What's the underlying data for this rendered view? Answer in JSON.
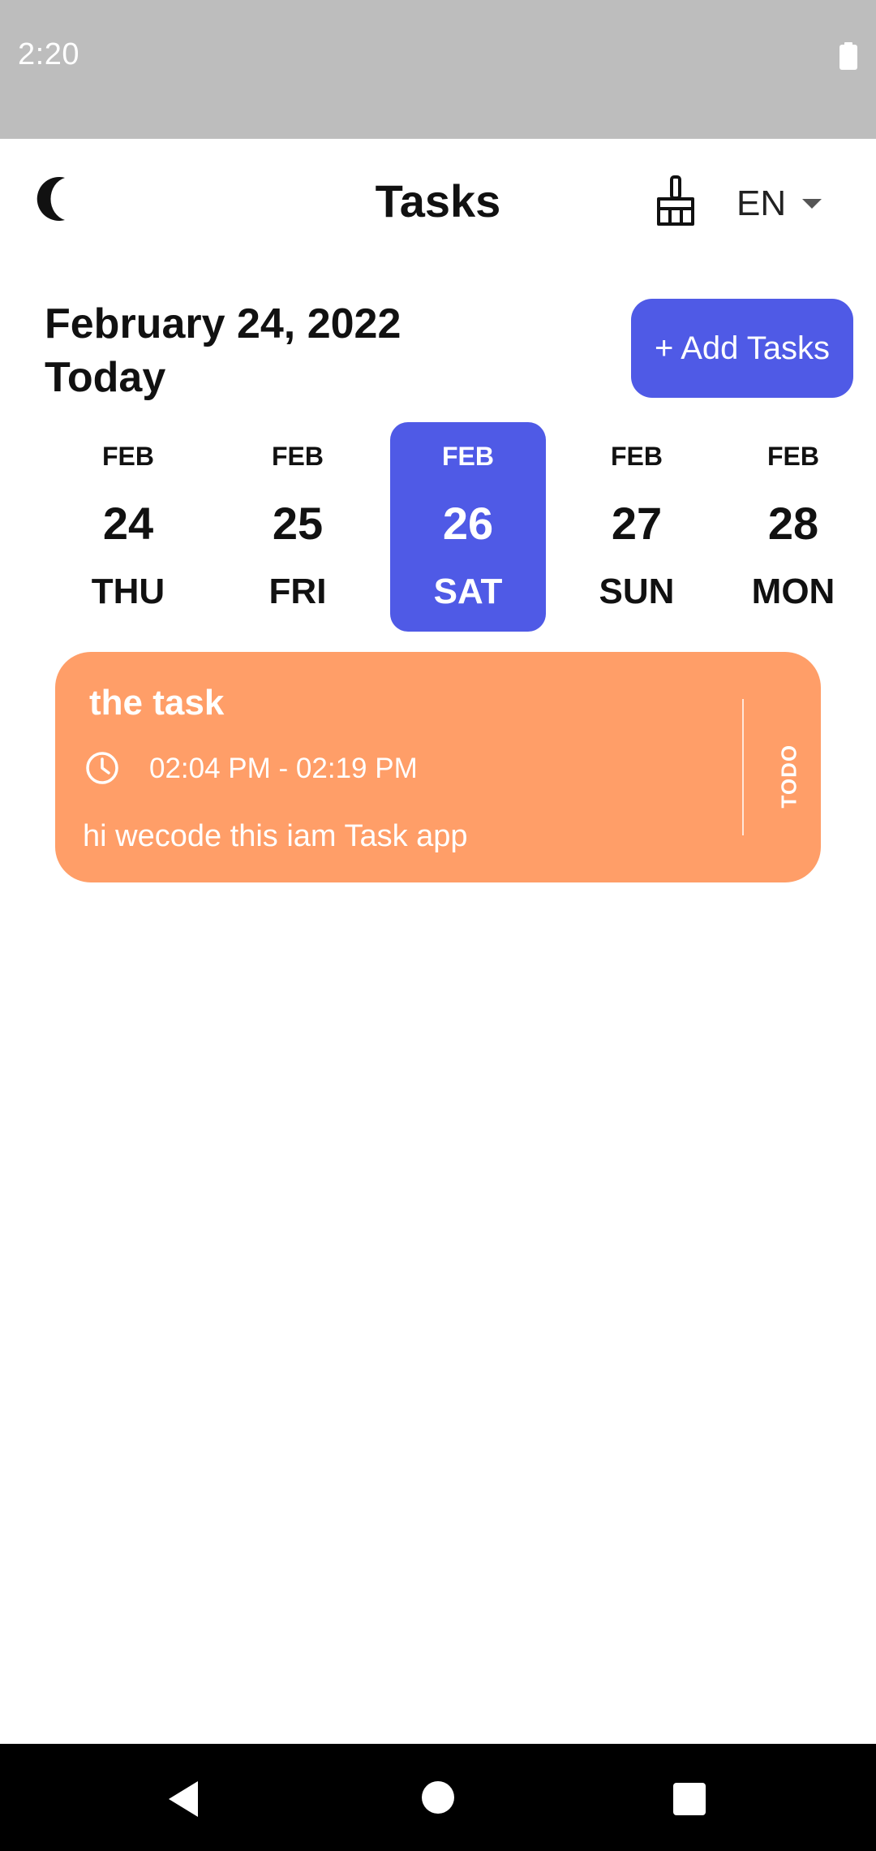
{
  "status_bar": {
    "time": "2:20"
  },
  "header": {
    "title": "Tasks",
    "language": "EN"
  },
  "date_block": {
    "date": "February 24, 2022",
    "label": "Today"
  },
  "add_button": {
    "label": "+ Add Tasks"
  },
  "date_strip": [
    {
      "month": "FEB",
      "day": "24",
      "weekday": "THU",
      "selected": false
    },
    {
      "month": "FEB",
      "day": "25",
      "weekday": "FRI",
      "selected": false
    },
    {
      "month": "FEB",
      "day": "26",
      "weekday": "SAT",
      "selected": true
    },
    {
      "month": "FEB",
      "day": "27",
      "weekday": "SUN",
      "selected": false
    },
    {
      "month": "FEB",
      "day": "28",
      "weekday": "MON",
      "selected": false
    }
  ],
  "task": {
    "title": "the task",
    "time": "02:04 PM - 02:19 PM",
    "description": "hi wecode this iam Task app",
    "status": "TODO"
  },
  "colors": {
    "accent": "#4f5ae6",
    "task_card": "#ff9e68",
    "status_bar": "#bdbdbd"
  }
}
